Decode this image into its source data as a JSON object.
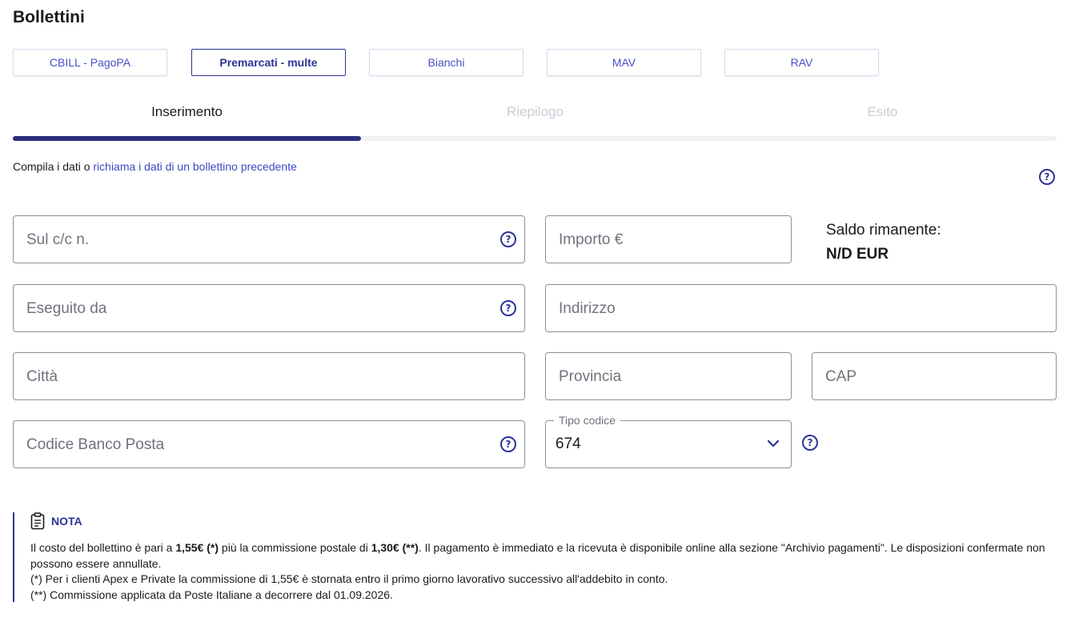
{
  "page_title": "Bollettini",
  "type_tabs": [
    {
      "label": "CBILL - PagoPA",
      "active": false
    },
    {
      "label": "Premarcati - multe",
      "active": true
    },
    {
      "label": "Bianchi",
      "active": false
    },
    {
      "label": "MAV",
      "active": false
    },
    {
      "label": "RAV",
      "active": false
    }
  ],
  "steps": [
    "Inserimento",
    "Riepilogo",
    "Esito"
  ],
  "active_step": 0,
  "intro": {
    "prefix": "Compila i dati o ",
    "link": "richiama i dati di un bollettino precedente"
  },
  "form": {
    "conto_placeholder": "Sul c/c n.",
    "importo_placeholder": "Importo €",
    "eseguito_placeholder": "Eseguito da",
    "indirizzo_placeholder": "Indirizzo",
    "citta_placeholder": "Città",
    "provincia_placeholder": "Provincia",
    "cap_placeholder": "CAP",
    "codice_placeholder": "Codice Banco Posta",
    "tipo_codice_label": "Tipo codice",
    "tipo_codice_value": "674"
  },
  "saldo": {
    "label": "Saldo rimanente:",
    "value": "N/D EUR"
  },
  "note": {
    "title": "NOTA",
    "line1_a": "Il costo del bollettino è pari a ",
    "line1_b": "1,55€ (*)",
    "line1_c": " più la commissione postale di ",
    "line1_d": "1,30€ (**)",
    "line1_e": ". Il pagamento è immediato e la ricevuta è disponibile online alla sezione \"Archivio pagamenti\". Le disposizioni confermate non possono essere annullate.",
    "line2": "(*) Per i clienti Apex e Private la commissione di 1,55€ è stornata entro il primo giorno lavorativo successivo all'addebito in conto.",
    "line3": "(**) Commissione applicata da Poste Italiane a decorrere dal 01.09.2026."
  },
  "icons": {
    "help": "help-circle-icon",
    "chevron": "chevron-down-icon",
    "note": "clipboard-icon"
  },
  "colors": {
    "primary": "#2c3494",
    "link": "#3d48c2",
    "step_bar": "#2a2f7e"
  }
}
